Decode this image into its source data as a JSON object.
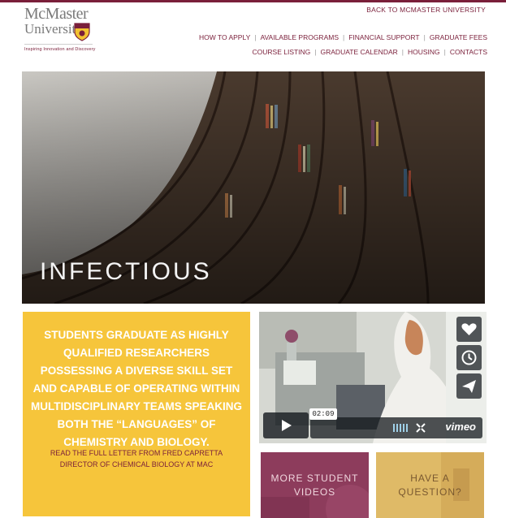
{
  "header": {
    "logo_name_line1": "McMaster",
    "logo_name_line2": "University",
    "logo_tagline": "Inspiring Innovation and Discovery",
    "back_link": "BACK TO MCMASTER UNIVERSITY",
    "nav_row1": [
      "HOW TO APPLY",
      "AVAILABLE PROGRAMS",
      "FINANCIAL SUPPORT",
      "GRADUATE FEES"
    ],
    "nav_row2": [
      "COURSE LISTING",
      "GRADUATE CALENDAR",
      "HOUSING",
      "CONTACTS"
    ],
    "colors": {
      "accent": "#7a1f3a",
      "separator": "#999999"
    }
  },
  "hero": {
    "title": "INFECTIOUS",
    "image_icon": "library-bookshelves-photo"
  },
  "feature": {
    "text": "STUDENTS GRADUATE AS HIGHLY QUALIFIED RESEARCHERS POSSESSING A DIVERSE SKILL SET AND CAPABLE OF OPERATING WITHIN MULTIDISCIPLINARY TEAMS SPEAKING BOTH THE “LANGUAGES” OF CHEMISTRY AND BIOLOGY.",
    "link_line1": "READ THE FULL LETTER FROM FRED CAPRETTA",
    "link_line2": "DIRECTOR OF CHEMICAL BIOLOGY AT MAC",
    "background_color": "#f6c53b"
  },
  "video": {
    "duration": "02:09",
    "brand": "vimeo",
    "side_icons": [
      "heart-icon",
      "clock-icon",
      "send-icon"
    ],
    "control_icons": [
      "play-icon",
      "volume-icon",
      "fullscreen-icon"
    ]
  },
  "tiles": {
    "more_videos_line1": "MORE STUDENT",
    "more_videos_line2": "VIDEOS",
    "question_line1": "HAVE A",
    "question_line2": "QUESTION?",
    "colors": {
      "videos": "#8d3c5c",
      "question": "#dfba67"
    }
  }
}
